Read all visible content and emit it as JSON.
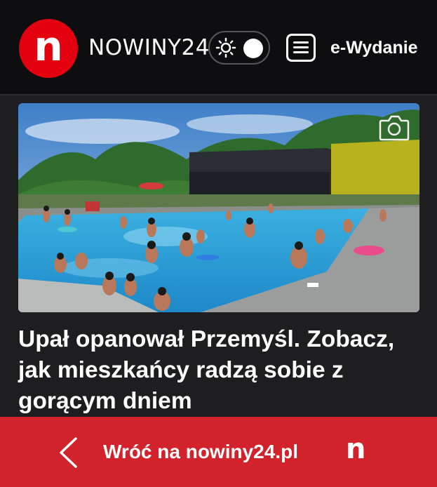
{
  "header": {
    "logo_letter": "n",
    "brand_name": "NOWINY24",
    "theme_toggle_icon": "sun-icon",
    "menu_icon": "hamburger-menu-icon",
    "edition_label": "e-Wydanie"
  },
  "article": {
    "image_alt": "Ludzie kąpiący się na basenie odkrytym w Przemyślu",
    "camera_icon": "camera-icon",
    "headline": "Upał opanował Przemyśl. Zobacz, jak mieszkańcy radzą sobie z gorącym dniem"
  },
  "bottom_bar": {
    "back_icon": "chevron-left-icon",
    "back_label": "Wróć na nowiny24.pl",
    "logo_letter": "n"
  },
  "colors": {
    "brand_red": "#e3000f",
    "bar_red": "#d2222b",
    "header_bg": "#0e0e10",
    "page_bg": "#1e1e20"
  }
}
